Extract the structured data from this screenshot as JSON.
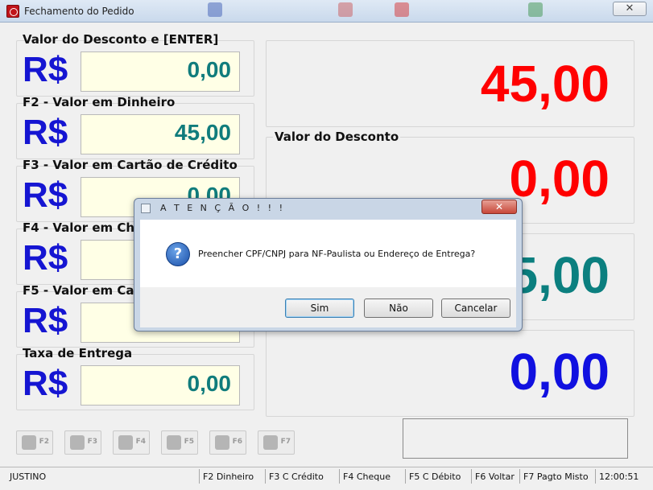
{
  "window": {
    "title": "Fechamento do Pedido",
    "close_glyph": "✕"
  },
  "left_fields": [
    {
      "label": "Valor do Desconto e [ENTER]",
      "currency": "R$",
      "value": "0,00"
    },
    {
      "label": "F2 - Valor em Dinheiro",
      "currency": "R$",
      "value": "45,00"
    },
    {
      "label": "F3 - Valor em Cartão de Crédito",
      "currency": "R$",
      "value": "0,00"
    },
    {
      "label": "F4 - Valor em Cheque",
      "currency": "R$",
      "value": ""
    },
    {
      "label": "F5 - Valor em Cartão de Débito",
      "currency": "R$",
      "value": ""
    },
    {
      "label": "Taxa de Entrega",
      "currency": "R$",
      "value": "0,00"
    }
  ],
  "right_panels": {
    "total": {
      "value": "45,00",
      "color": "#ff0000"
    },
    "discount": {
      "label": "Valor do Desconto",
      "value": "0,00",
      "color": "#ff0000"
    },
    "paid": {
      "value": "45,00",
      "color": "#0b7f7f"
    },
    "change": {
      "value": "0,00",
      "color": "#1010e0"
    }
  },
  "function_buttons": [
    {
      "key": "F2",
      "icon": "money-hand-icon"
    },
    {
      "key": "F3",
      "icon": "credit-card-icon"
    },
    {
      "key": "F4",
      "icon": "check-icon"
    },
    {
      "key": "F5",
      "icon": "debit-card-icon"
    },
    {
      "key": "F6",
      "icon": "back-icon"
    },
    {
      "key": "F7",
      "icon": "mixed-payment-icon"
    }
  ],
  "statusbar": {
    "user": "JUSTINO",
    "items": [
      "F2 Dinheiro",
      "F3 C Crédito",
      "F4 Cheque",
      "F5 C Débito",
      "F6 Voltar",
      "F7 Pagto Misto"
    ],
    "time": "12:00:51"
  },
  "dialog": {
    "title": "A T E N Ç Ã O   ! ! !",
    "message": "Preencher CPF/CNPJ para NF-Paulista ou Endereço de Entrega?",
    "buttons": {
      "yes": "Sim",
      "no": "Não",
      "cancel": "Cancelar"
    },
    "close_glyph": "✕",
    "icon": "question-icon"
  },
  "colors": {
    "currency": "#1515d2",
    "field_value": "#107c7c",
    "field_bg": "#ffffe6"
  }
}
